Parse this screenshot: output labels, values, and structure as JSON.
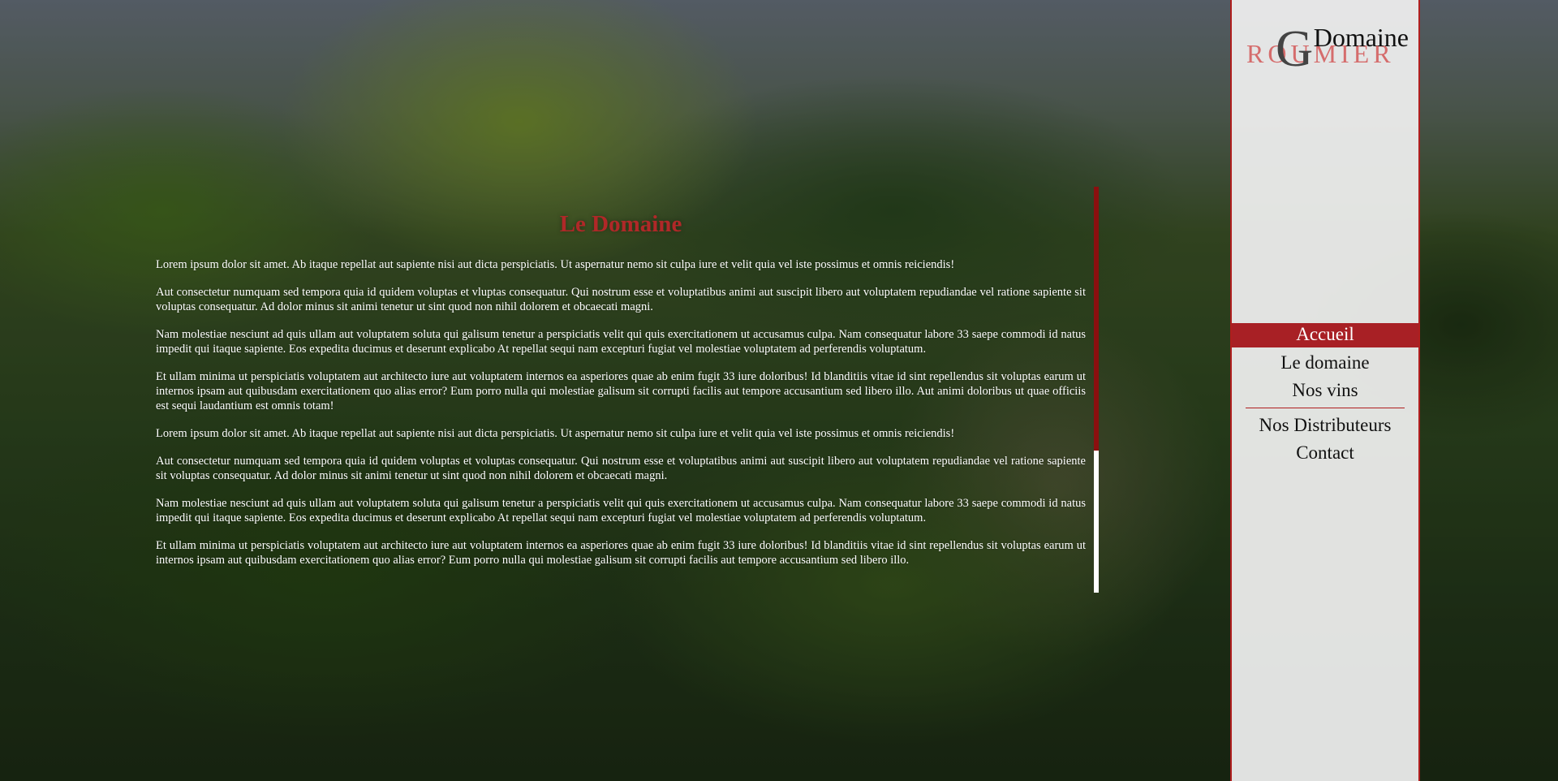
{
  "page": {
    "title": "Le Domaine",
    "paragraphs": [
      "Lorem ipsum dolor sit amet. Ab itaque repellat aut sapiente nisi aut dicta perspiciatis. Ut aspernatur nemo sit culpa iure et velit quia vel iste possimus et omnis reiciendis!",
      "Aut consectetur numquam sed tempora quia id quidem voluptas et vluptas consequatur. Qui nostrum esse et voluptatibus animi aut suscipit libero aut voluptatem repudiandae vel ratione sapiente sit voluptas consequatur. Ad dolor minus sit animi tenetur ut sint quod non nihil dolorem et obcaecati magni.",
      "Nam molestiae nesciunt ad quis ullam aut voluptatem soluta qui galisum tenetur a perspiciatis velit qui quis exercitationem ut accusamus culpa. Nam consequatur labore 33 saepe commodi id natus impedit qui itaque sapiente. Eos expedita ducimus et deserunt explicabo At repellat sequi nam excepturi fugiat vel molestiae voluptatem ad perferendis voluptatum.",
      "Et ullam minima ut perspiciatis voluptatem aut architecto iure aut voluptatem internos ea asperiores quae ab enim fugit 33 iure doloribus! Id blanditiis vitae id sint repellendus sit voluptas earum ut internos ipsam aut quibusdam exercitationem quo alias error? Eum porro nulla qui molestiae galisum sit corrupti facilis aut tempore accusantium sed libero illo. Aut animi doloribus ut quae officiis est sequi laudantium est omnis totam!",
      "Lorem ipsum dolor sit amet. Ab itaque repellat aut sapiente nisi aut dicta perspiciatis. Ut aspernatur nemo sit culpa iure et velit quia vel iste possimus et omnis reiciendis!",
      "Aut consectetur numquam sed tempora quia id quidem voluptas et voluptas consequatur. Qui nostrum esse et voluptatibus animi aut suscipit libero aut voluptatem repudiandae vel ratione sapiente sit voluptas consequatur. Ad dolor minus sit animi tenetur ut sint quod non nihil dolorem et obcaecati magni.",
      "Nam molestiae nesciunt ad quis ullam aut voluptatem soluta qui galisum tenetur a perspiciatis velit qui quis exercitationem ut accusamus culpa. Nam consequatur labore 33 saepe commodi id natus impedit qui itaque sapiente. Eos expedita ducimus et deserunt explicabo At repellat sequi nam excepturi fugiat vel molestiae voluptatem ad perferendis voluptatum.",
      "Et ullam minima ut perspiciatis voluptatem aut architecto iure aut voluptatem internos ea asperiores quae ab enim fugit 33 iure doloribus! Id blanditiis vitae id sint repellendus sit voluptas earum ut internos ipsam aut quibusdam exercitationem quo alias error? Eum porro nulla qui molestiae galisum sit corrupti facilis aut tempore accusantium sed libero illo."
    ]
  },
  "logo": {
    "letter": "G",
    "top_word": "Domaine",
    "bottom_word": "ROUMIER"
  },
  "nav": {
    "items": [
      "Accueil",
      "Le domaine",
      "Nos vins",
      "Nos Distributeurs",
      "Contact"
    ],
    "active": "Accueil"
  },
  "scroll": {
    "position_fraction": 0.0,
    "visible_fraction": 0.65
  },
  "colors": {
    "accent": "#a82025",
    "title": "#b02828",
    "scroll_thumb": "#8b0f0f",
    "sidebar_bg": "#f0f0f0"
  }
}
